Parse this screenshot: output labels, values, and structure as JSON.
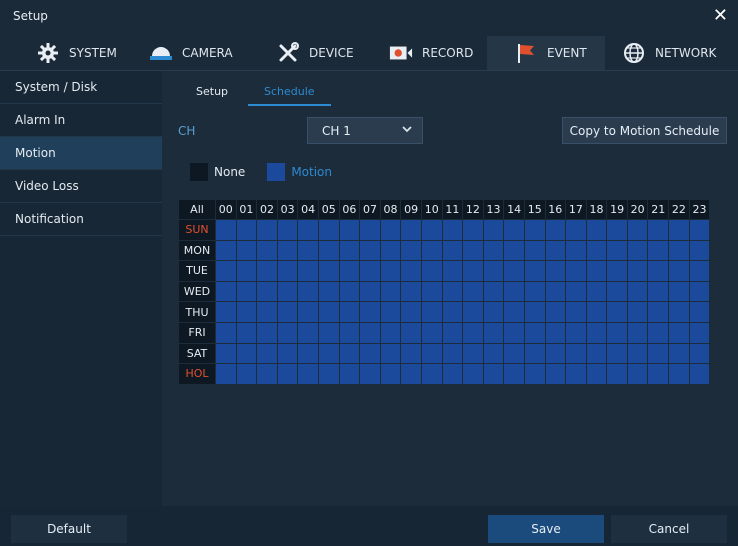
{
  "window": {
    "title": "Setup",
    "close_glyph": "✕"
  },
  "tabs": [
    {
      "label": "SYSTEM",
      "icon": "gear-icon"
    },
    {
      "label": "CAMERA",
      "icon": "camera-icon"
    },
    {
      "label": "DEVICE",
      "icon": "tools-icon"
    },
    {
      "label": "RECORD",
      "icon": "record-icon"
    },
    {
      "label": "EVENT",
      "icon": "flag-icon",
      "active": true
    },
    {
      "label": "NETWORK",
      "icon": "globe-icon"
    }
  ],
  "sidebar": {
    "items": [
      {
        "label": "System / Disk"
      },
      {
        "label": "Alarm In"
      },
      {
        "label": "Motion",
        "active": true
      },
      {
        "label": "Video Loss"
      },
      {
        "label": "Notification"
      }
    ]
  },
  "subtabs": [
    {
      "label": "Setup"
    },
    {
      "label": "Schedule",
      "active": true
    }
  ],
  "channel": {
    "label": "CH",
    "value": "CH 1"
  },
  "copy_button": "Copy to Motion Schedule",
  "legend": {
    "none_label": "None",
    "motion_label": "Motion",
    "none_color": "#0e1822",
    "motion_color": "#1b4a9c"
  },
  "schedule": {
    "all_label": "All",
    "hours": [
      "00",
      "01",
      "02",
      "03",
      "04",
      "05",
      "06",
      "07",
      "08",
      "09",
      "10",
      "11",
      "12",
      "13",
      "14",
      "15",
      "16",
      "17",
      "18",
      "19",
      "20",
      "21",
      "22",
      "23"
    ],
    "days": [
      {
        "label": "SUN",
        "color": "#e0502f"
      },
      {
        "label": "MON",
        "color": "#e4ebf1"
      },
      {
        "label": "TUE",
        "color": "#e4ebf1"
      },
      {
        "label": "WED",
        "color": "#e4ebf1"
      },
      {
        "label": "THU",
        "color": "#e4ebf1"
      },
      {
        "label": "FRI",
        "color": "#e4ebf1"
      },
      {
        "label": "SAT",
        "color": "#e4ebf1"
      },
      {
        "label": "HOL",
        "color": "#e0502f"
      }
    ],
    "cell_state": "Motion"
  },
  "buttons": {
    "default": "Default",
    "save": "Save",
    "cancel": "Cancel"
  },
  "colors": {
    "accent": "#2d8bd1",
    "active_sidebar": "#1f3f5b",
    "save_button": "#1b4a7d",
    "motion": "#1b4a9c"
  }
}
